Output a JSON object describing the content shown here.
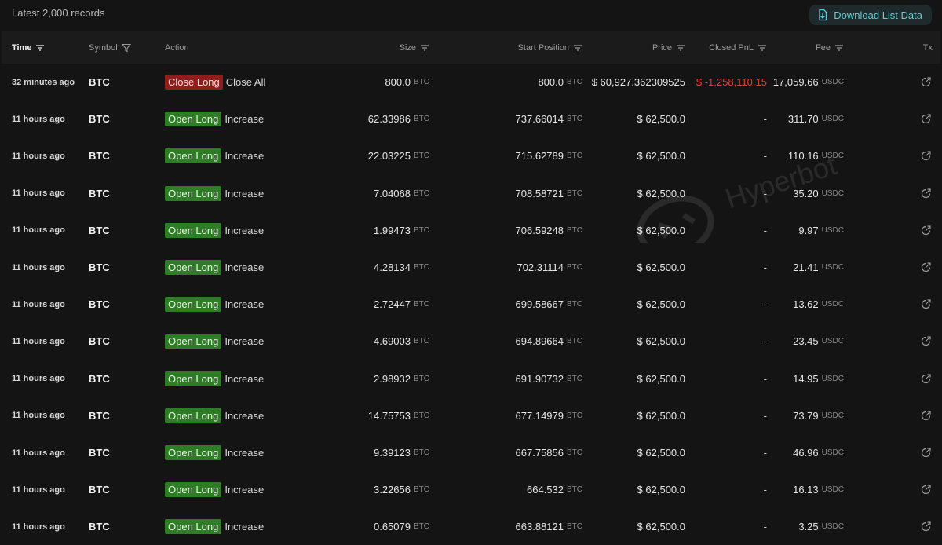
{
  "topbar": {
    "records_label": "Latest 2,000 records",
    "download_label": "Download List Data"
  },
  "columns": {
    "time": "Time",
    "symbol": "Symbol",
    "action": "Action",
    "size": "Size",
    "start_position": "Start Position",
    "price": "Price",
    "closed_pnl": "Closed PnL",
    "fee": "Fee",
    "tx": "Tx"
  },
  "watermark": {
    "text": "Hyperbot"
  },
  "colors": {
    "open_tag": "#2e7d26",
    "close_tag": "#8e1d1b",
    "negative": "#e53d3d",
    "accent": "#5fd0d6"
  },
  "rows": [
    {
      "time": "32 minutes ago",
      "symbol": "BTC",
      "tag": "Close Long",
      "tag_type": "close",
      "detail": "Close All",
      "size": "800.0",
      "size_unit": "BTC",
      "start": "800.0",
      "start_unit": "BTC",
      "price": "$ 60,927.362309525",
      "pnl": "$ -1,258,110.15",
      "pnl_negative": true,
      "fee": "17,059.66",
      "fee_unit": "USDC"
    },
    {
      "time": "11 hours ago",
      "symbol": "BTC",
      "tag": "Open Long",
      "tag_type": "open",
      "detail": "Increase",
      "size": "62.33986",
      "size_unit": "BTC",
      "start": "737.66014",
      "start_unit": "BTC",
      "price": "$ 62,500.0",
      "pnl": "-",
      "pnl_negative": false,
      "fee": "311.70",
      "fee_unit": "USDC"
    },
    {
      "time": "11 hours ago",
      "symbol": "BTC",
      "tag": "Open Long",
      "tag_type": "open",
      "detail": "Increase",
      "size": "22.03225",
      "size_unit": "BTC",
      "start": "715.62789",
      "start_unit": "BTC",
      "price": "$ 62,500.0",
      "pnl": "-",
      "pnl_negative": false,
      "fee": "110.16",
      "fee_unit": "USDC"
    },
    {
      "time": "11 hours ago",
      "symbol": "BTC",
      "tag": "Open Long",
      "tag_type": "open",
      "detail": "Increase",
      "size": "7.04068",
      "size_unit": "BTC",
      "start": "708.58721",
      "start_unit": "BTC",
      "price": "$ 62,500.0",
      "pnl": "-",
      "pnl_negative": false,
      "fee": "35.20",
      "fee_unit": "USDC"
    },
    {
      "time": "11 hours ago",
      "symbol": "BTC",
      "tag": "Open Long",
      "tag_type": "open",
      "detail": "Increase",
      "size": "1.99473",
      "size_unit": "BTC",
      "start": "706.59248",
      "start_unit": "BTC",
      "price": "$ 62,500.0",
      "pnl": "-",
      "pnl_negative": false,
      "fee": "9.97",
      "fee_unit": "USDC"
    },
    {
      "time": "11 hours ago",
      "symbol": "BTC",
      "tag": "Open Long",
      "tag_type": "open",
      "detail": "Increase",
      "size": "4.28134",
      "size_unit": "BTC",
      "start": "702.31114",
      "start_unit": "BTC",
      "price": "$ 62,500.0",
      "pnl": "-",
      "pnl_negative": false,
      "fee": "21.41",
      "fee_unit": "USDC"
    },
    {
      "time": "11 hours ago",
      "symbol": "BTC",
      "tag": "Open Long",
      "tag_type": "open",
      "detail": "Increase",
      "size": "2.72447",
      "size_unit": "BTC",
      "start": "699.58667",
      "start_unit": "BTC",
      "price": "$ 62,500.0",
      "pnl": "-",
      "pnl_negative": false,
      "fee": "13.62",
      "fee_unit": "USDC"
    },
    {
      "time": "11 hours ago",
      "symbol": "BTC",
      "tag": "Open Long",
      "tag_type": "open",
      "detail": "Increase",
      "size": "4.69003",
      "size_unit": "BTC",
      "start": "694.89664",
      "start_unit": "BTC",
      "price": "$ 62,500.0",
      "pnl": "-",
      "pnl_negative": false,
      "fee": "23.45",
      "fee_unit": "USDC"
    },
    {
      "time": "11 hours ago",
      "symbol": "BTC",
      "tag": "Open Long",
      "tag_type": "open",
      "detail": "Increase",
      "size": "2.98932",
      "size_unit": "BTC",
      "start": "691.90732",
      "start_unit": "BTC",
      "price": "$ 62,500.0",
      "pnl": "-",
      "pnl_negative": false,
      "fee": "14.95",
      "fee_unit": "USDC"
    },
    {
      "time": "11 hours ago",
      "symbol": "BTC",
      "tag": "Open Long",
      "tag_type": "open",
      "detail": "Increase",
      "size": "14.75753",
      "size_unit": "BTC",
      "start": "677.14979",
      "start_unit": "BTC",
      "price": "$ 62,500.0",
      "pnl": "-",
      "pnl_negative": false,
      "fee": "73.79",
      "fee_unit": "USDC"
    },
    {
      "time": "11 hours ago",
      "symbol": "BTC",
      "tag": "Open Long",
      "tag_type": "open",
      "detail": "Increase",
      "size": "9.39123",
      "size_unit": "BTC",
      "start": "667.75856",
      "start_unit": "BTC",
      "price": "$ 62,500.0",
      "pnl": "-",
      "pnl_negative": false,
      "fee": "46.96",
      "fee_unit": "USDC"
    },
    {
      "time": "11 hours ago",
      "symbol": "BTC",
      "tag": "Open Long",
      "tag_type": "open",
      "detail": "Increase",
      "size": "3.22656",
      "size_unit": "BTC",
      "start": "664.532",
      "start_unit": "BTC",
      "price": "$ 62,500.0",
      "pnl": "-",
      "pnl_negative": false,
      "fee": "16.13",
      "fee_unit": "USDC"
    },
    {
      "time": "11 hours ago",
      "symbol": "BTC",
      "tag": "Open Long",
      "tag_type": "open",
      "detail": "Increase",
      "size": "0.65079",
      "size_unit": "BTC",
      "start": "663.88121",
      "start_unit": "BTC",
      "price": "$ 62,500.0",
      "pnl": "-",
      "pnl_negative": false,
      "fee": "3.25",
      "fee_unit": "USDC"
    }
  ]
}
